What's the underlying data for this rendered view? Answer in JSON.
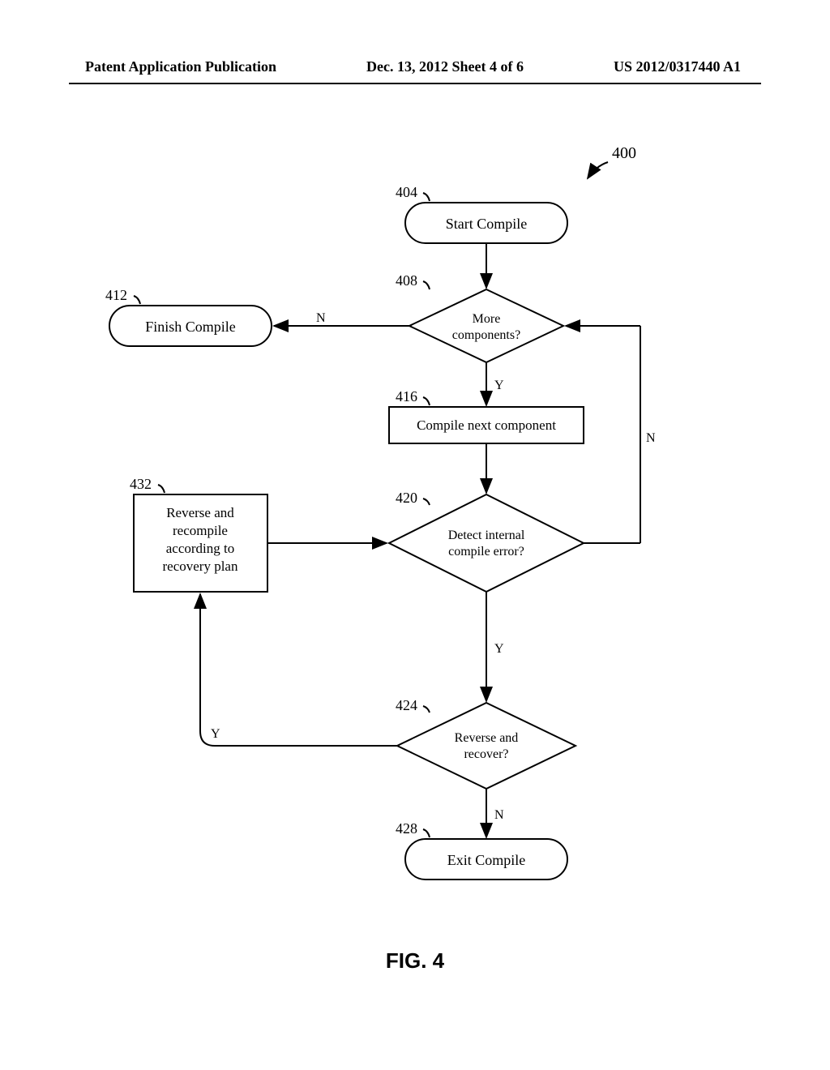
{
  "header": {
    "left": "Patent Application Publication",
    "center": "Dec. 13, 2012   Sheet 4 of 6",
    "right": "US 2012/0317440 A1"
  },
  "chart_data": {
    "type": "flowchart",
    "title": "FIG. 4",
    "flow_ref": "400",
    "nodes": [
      {
        "id": "404",
        "type": "terminator",
        "label": "Start Compile"
      },
      {
        "id": "408",
        "type": "decision",
        "label": "More components?"
      },
      {
        "id": "412",
        "type": "terminator",
        "label": "Finish Compile"
      },
      {
        "id": "416",
        "type": "process",
        "label": "Compile next component"
      },
      {
        "id": "420",
        "type": "decision",
        "label": "Detect internal compile error?"
      },
      {
        "id": "424",
        "type": "decision",
        "label": "Reverse and recover?"
      },
      {
        "id": "428",
        "type": "terminator",
        "label": "Exit Compile"
      },
      {
        "id": "432",
        "type": "process",
        "label": "Reverse and recompile according to recovery plan"
      }
    ],
    "edges": [
      {
        "from": "404",
        "to": "408",
        "label": ""
      },
      {
        "from": "408",
        "to": "412",
        "label": "N"
      },
      {
        "from": "408",
        "to": "416",
        "label": "Y"
      },
      {
        "from": "416",
        "to": "420",
        "label": ""
      },
      {
        "from": "420",
        "to": "408",
        "label": "N"
      },
      {
        "from": "420",
        "to": "424",
        "label": "Y"
      },
      {
        "from": "424",
        "to": "432",
        "label": "Y"
      },
      {
        "from": "424",
        "to": "428",
        "label": "N"
      },
      {
        "from": "432",
        "to": "420",
        "label": ""
      }
    ]
  }
}
